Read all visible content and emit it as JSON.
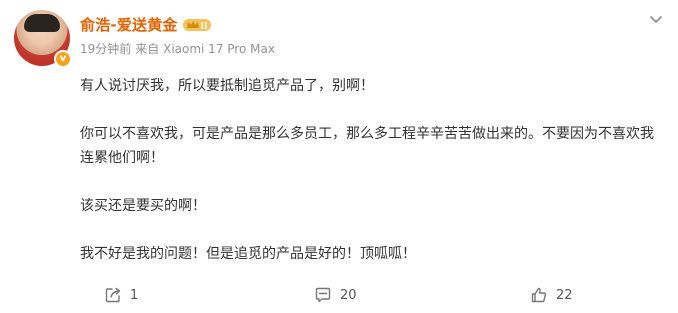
{
  "post": {
    "username": "俞浩-爱送黄金",
    "badge_text": "II",
    "time": "19分钟前",
    "source": "来自 Xiaomi 17 Pro Max",
    "paragraphs": [
      "有人说讨厌我，所以要抵制追觅产品了，别啊！",
      "你可以不喜欢我，可是产品是那么多员工，那么多工程辛辛苦苦做出来的。不要因为不喜欢我连累他们啊！",
      "该买还是要买的啊！",
      "我不好是我的问题！但是追觅的产品是好的！顶呱呱！"
    ],
    "actions": {
      "share_count": "1",
      "comment_count": "20",
      "like_count": "22"
    },
    "colors": {
      "username": "#e86100",
      "text": "#333333",
      "meta": "#939393",
      "badge": "#f7a21b"
    },
    "icons": {
      "more": "chevron-down-icon",
      "share": "share-icon",
      "comment": "comment-icon",
      "like": "thumbs-up-icon",
      "verified": "verified-v-icon",
      "crown": "crown-badge-icon"
    }
  }
}
